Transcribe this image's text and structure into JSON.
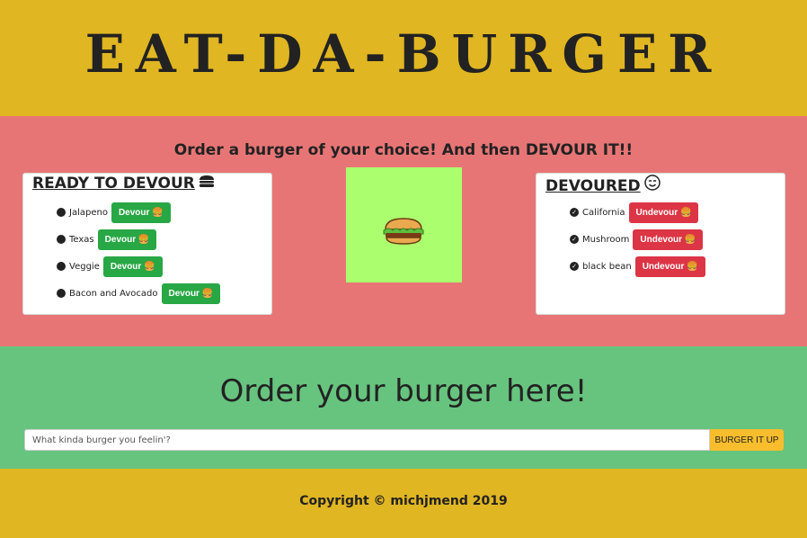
{
  "header": {
    "title": "EAT-DA-BURGER"
  },
  "main": {
    "tagline": "Order a burger of your choice! And then DEVOUR IT!!",
    "ready": {
      "heading": "READY TO DEVOUR",
      "heading_icon": "burger-icon",
      "items": [
        {
          "name": "Jalapeno",
          "button": "Devour 🍔"
        },
        {
          "name": "Texas",
          "button": "Devour 🍔"
        },
        {
          "name": "Veggie",
          "button": "Devour 🍔"
        },
        {
          "name": "Bacon and Avocado",
          "button": "Devour 🍔"
        }
      ]
    },
    "devoured": {
      "heading": "DEVOURED",
      "heading_icon": "smiley-icon",
      "items": [
        {
          "name": "California",
          "button": "Undevour 🍔"
        },
        {
          "name": "Mushroom",
          "button": "Undevour 🍔"
        },
        {
          "name": "black bean",
          "button": "Undevour 🍔"
        }
      ]
    },
    "image": {
      "icon": "burger-image"
    }
  },
  "order": {
    "title": "Order your burger here!",
    "input_placeholder": "What kinda burger you feelin'?",
    "submit_label": "BURGER IT UP"
  },
  "footer": {
    "copyright": "Copyright © michjmend 2019"
  },
  "colors": {
    "header_bg": "#e0b622",
    "middle_bg": "#e87575",
    "order_bg": "#67c47f",
    "image_bg": "#abff6e",
    "devour_button": "#28a745",
    "undevour_button": "#dc3545",
    "submit_button": "#f7bd2c"
  }
}
